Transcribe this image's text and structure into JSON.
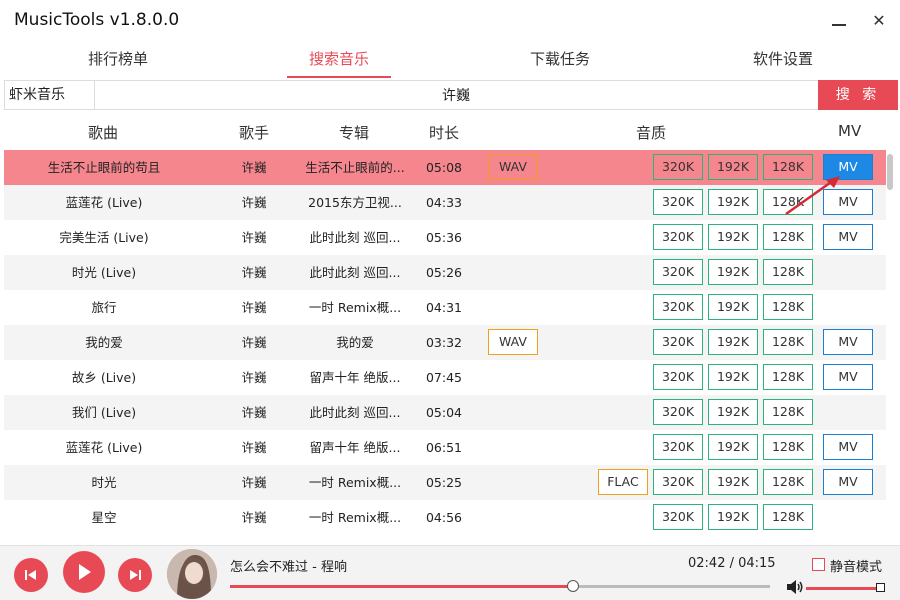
{
  "app": {
    "title": "MusicTools v1.8.0.0"
  },
  "window": {
    "minimize_icon": "minimize-icon",
    "close_icon": "close-icon",
    "close_glyph": "✕"
  },
  "tabs": [
    {
      "label": "排行榜单",
      "active": false
    },
    {
      "label": "搜索音乐",
      "active": true
    },
    {
      "label": "下载任务",
      "active": false
    },
    {
      "label": "软件设置",
      "active": false
    }
  ],
  "search": {
    "source": "虾米音乐",
    "query": "许巍",
    "button_label": "搜 索"
  },
  "columns": {
    "song": "歌曲",
    "singer": "歌手",
    "album": "专辑",
    "duration": "时长",
    "quality": "音质",
    "mv": "MV"
  },
  "rows": [
    {
      "song": "生活不止眼前的苟且",
      "singer": "许巍",
      "album": "生活不止眼前的...",
      "duration": "05:08",
      "format": "WAV",
      "qualities": [
        "320K",
        "192K",
        "128K"
      ],
      "mv": "MV",
      "selected": true
    },
    {
      "song": "蓝莲花 (Live)",
      "singer": "许巍",
      "album": "2015东方卫视...",
      "duration": "04:33",
      "format": "",
      "qualities": [
        "320K",
        "192K",
        "128K"
      ],
      "mv": "MV",
      "selected": false
    },
    {
      "song": "完美生活 (Live)",
      "singer": "许巍",
      "album": "此时此刻 巡回...",
      "duration": "05:36",
      "format": "",
      "qualities": [
        "320K",
        "192K",
        "128K"
      ],
      "mv": "MV",
      "selected": false
    },
    {
      "song": "时光 (Live)",
      "singer": "许巍",
      "album": "此时此刻 巡回...",
      "duration": "05:26",
      "format": "",
      "qualities": [
        "320K",
        "192K",
        "128K"
      ],
      "mv": "",
      "selected": false
    },
    {
      "song": "旅行",
      "singer": "许巍",
      "album": "一时 Remix概...",
      "duration": "04:31",
      "format": "",
      "qualities": [
        "320K",
        "192K",
        "128K"
      ],
      "mv": "",
      "selected": false
    },
    {
      "song": "我的爱",
      "singer": "许巍",
      "album": "我的爱",
      "duration": "03:32",
      "format": "WAV",
      "qualities": [
        "320K",
        "192K",
        "128K"
      ],
      "mv": "MV",
      "selected": false
    },
    {
      "song": "故乡 (Live)",
      "singer": "许巍",
      "album": "留声十年 绝版...",
      "duration": "07:45",
      "format": "",
      "qualities": [
        "320K",
        "192K",
        "128K"
      ],
      "mv": "MV",
      "selected": false
    },
    {
      "song": "我们 (Live)",
      "singer": "许巍",
      "album": "此时此刻 巡回...",
      "duration": "05:04",
      "format": "",
      "qualities": [
        "320K",
        "192K",
        "128K"
      ],
      "mv": "",
      "selected": false
    },
    {
      "song": "蓝莲花 (Live)",
      "singer": "许巍",
      "album": "留声十年 绝版...",
      "duration": "06:51",
      "format": "",
      "qualities": [
        "320K",
        "192K",
        "128K"
      ],
      "mv": "MV",
      "selected": false
    },
    {
      "song": "时光",
      "singer": "许巍",
      "album": "一时 Remix概...",
      "duration": "05:25",
      "format": "FLAC",
      "qualities": [
        "320K",
        "192K",
        "128K"
      ],
      "mv": "MV",
      "selected": false
    },
    {
      "song": "星空",
      "singer": "许巍",
      "album": "一时 Remix概...",
      "duration": "04:56",
      "format": "",
      "qualities": [
        "320K",
        "192K",
        "128K"
      ],
      "mv": "",
      "selected": false
    }
  ],
  "player": {
    "now_playing": "怎么会不难过 - 程响",
    "time": "02:42 / 04:15",
    "progress": 0.635,
    "volume": 1.0,
    "mute_label": "静音模式",
    "mute_checked": false
  },
  "colors": {
    "accent": "#e84a55",
    "selected_row": "#f5868e",
    "quality_border": "#2db37a",
    "format_border": "#f0a020",
    "mv_border": "#1a7fd1",
    "mv_active": "#1e88e5"
  },
  "icons": {
    "prev": "skip-previous-icon",
    "play": "play-icon",
    "next": "skip-next-icon",
    "volume": "volume-icon"
  }
}
